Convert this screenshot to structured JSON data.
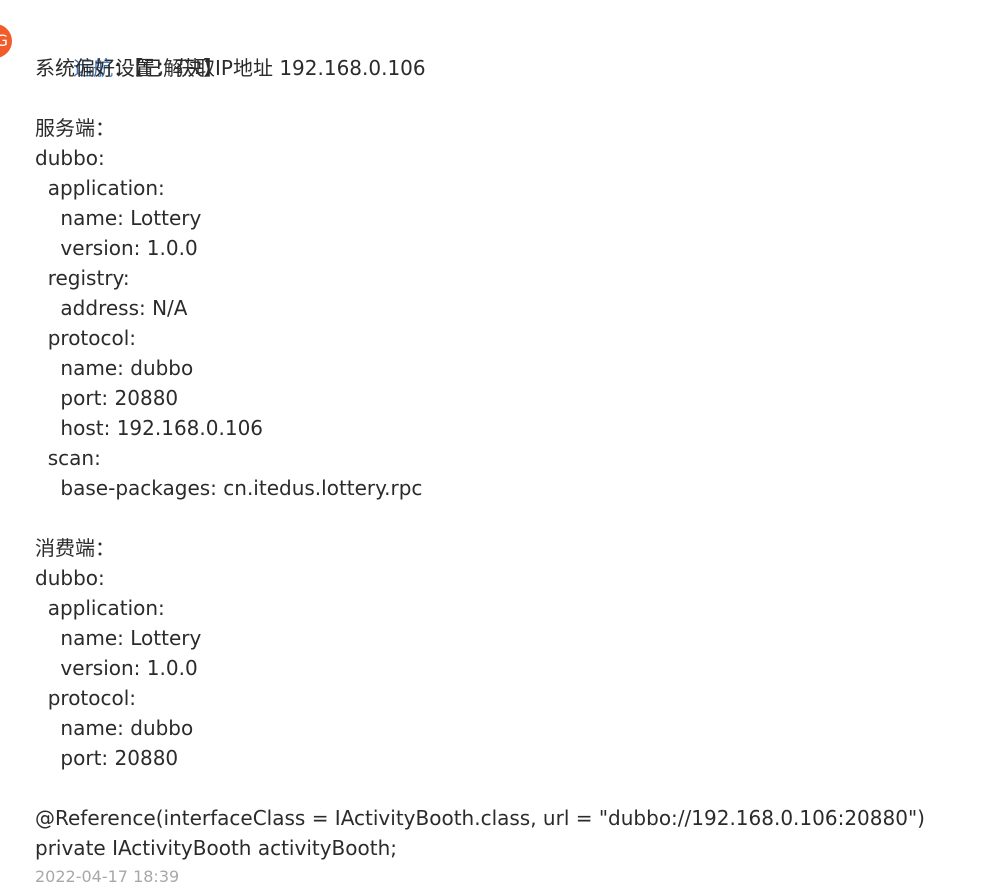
{
  "comment": {
    "author": "远航",
    "author_separator": "：",
    "status": "【已解决】",
    "avatar_text": "G",
    "lines": [
      "系统偏好设置：获取IP地址 192.168.0.106",
      "",
      "服务端：",
      "dubbo:",
      "  application:",
      "    name: Lottery",
      "    version: 1.0.0",
      "  registry:",
      "    address: N/A",
      "  protocol:",
      "    name: dubbo",
      "    port: 20880",
      "    host: 192.168.0.106",
      "  scan:",
      "    base-packages: cn.itedus.lottery.rpc",
      "",
      "消费端：",
      "dubbo:",
      "  application:",
      "    name: Lottery",
      "    version: 1.0.0",
      "  protocol:",
      "    name: dubbo",
      "    port: 20880",
      "",
      "@Reference(interfaceClass = IActivityBooth.class, url = \"dubbo://192.168.0.106:20880\")",
      "private IActivityBooth activityBooth;"
    ],
    "timestamp": "2022-04-17 18:39"
  }
}
